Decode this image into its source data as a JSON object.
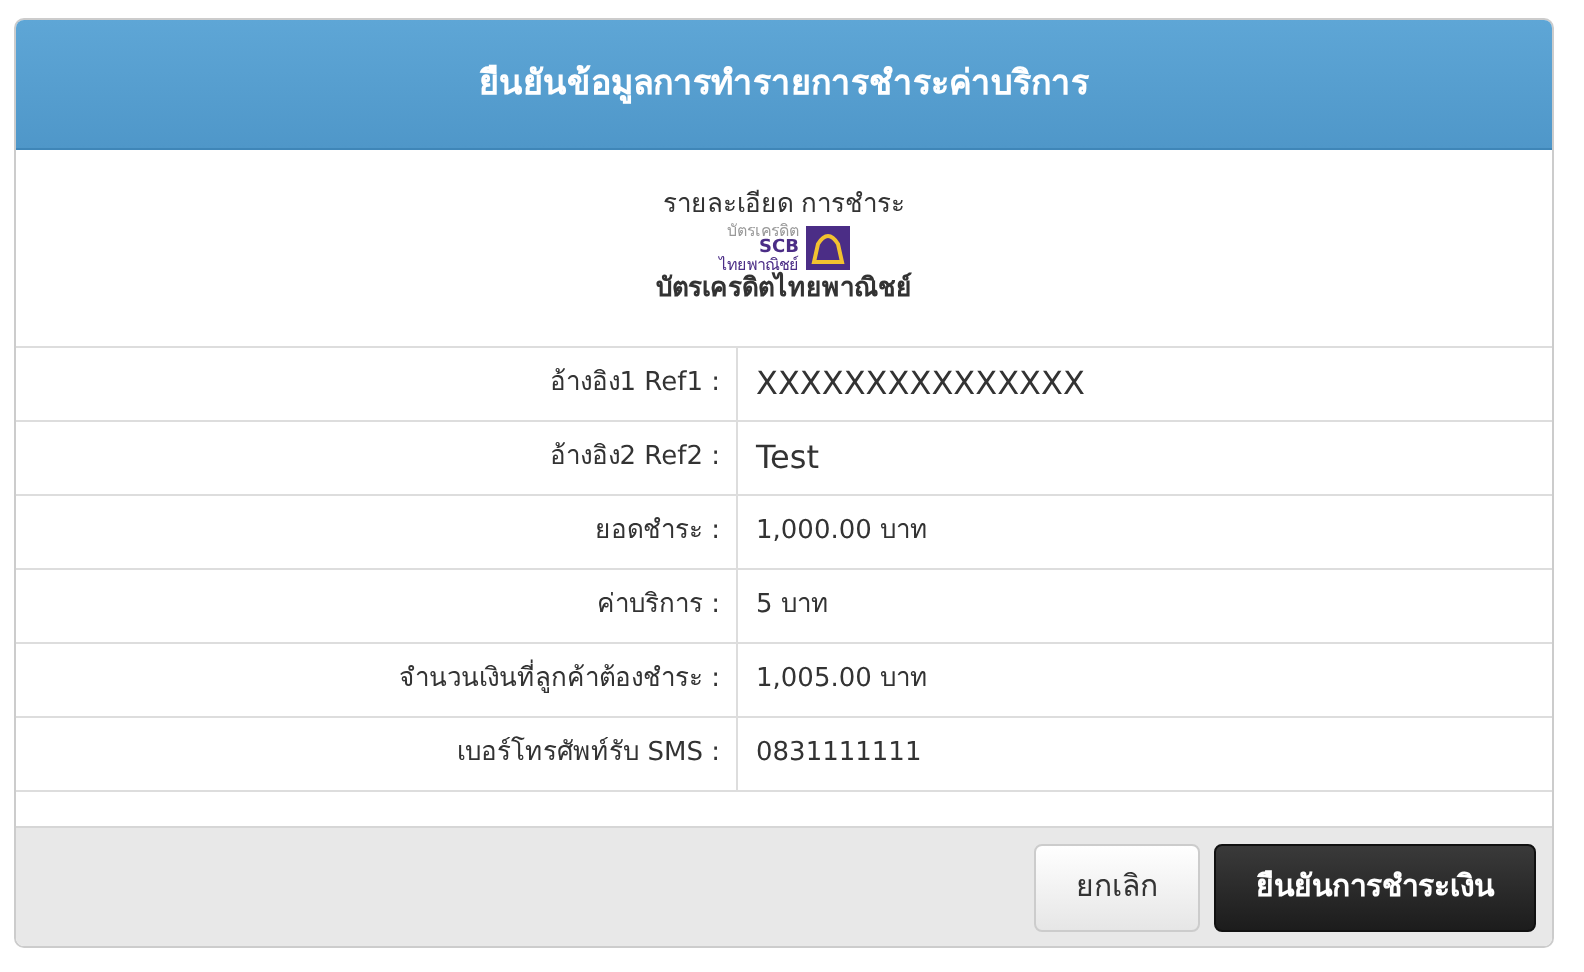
{
  "dialog": {
    "title": "ยืนยันข้อมูลการทำรายการชำระค่าบริการ"
  },
  "details": {
    "heading": "รายละเอียด การชำระ",
    "logo": {
      "caption": "บัตรเครดิต",
      "brand": "SCB",
      "bank": "ไทยพาณิชย์"
    },
    "card_name": "บัตรเครดิตไทยพาณิชย์"
  },
  "rows": [
    {
      "label": "อ้างอิง1 Ref1 :",
      "value": "XXXXXXXXXXXXXXX",
      "kind": "reference"
    },
    {
      "label": "อ้างอิง2 Ref2 :",
      "value": "Test",
      "kind": "reference"
    },
    {
      "label": "ยอดชำระ :",
      "value": "1,000.00 บาท",
      "kind": "plain"
    },
    {
      "label": "ค่าบริการ :",
      "value": "5 บาท",
      "kind": "plain"
    },
    {
      "label": "จำนวนเงินที่ลูกค้าต้องชำระ :",
      "value": "1,005.00 บาท",
      "kind": "plain"
    },
    {
      "label": "เบอร์โทรศัพท์รับ SMS :",
      "value": "0831111111",
      "kind": "plain"
    }
  ],
  "buttons": [
    {
      "label": "ยกเลิก",
      "kind": "secondary"
    },
    {
      "label": "ยืนยันการชำระเงิน",
      "kind": "primary"
    }
  ]
}
